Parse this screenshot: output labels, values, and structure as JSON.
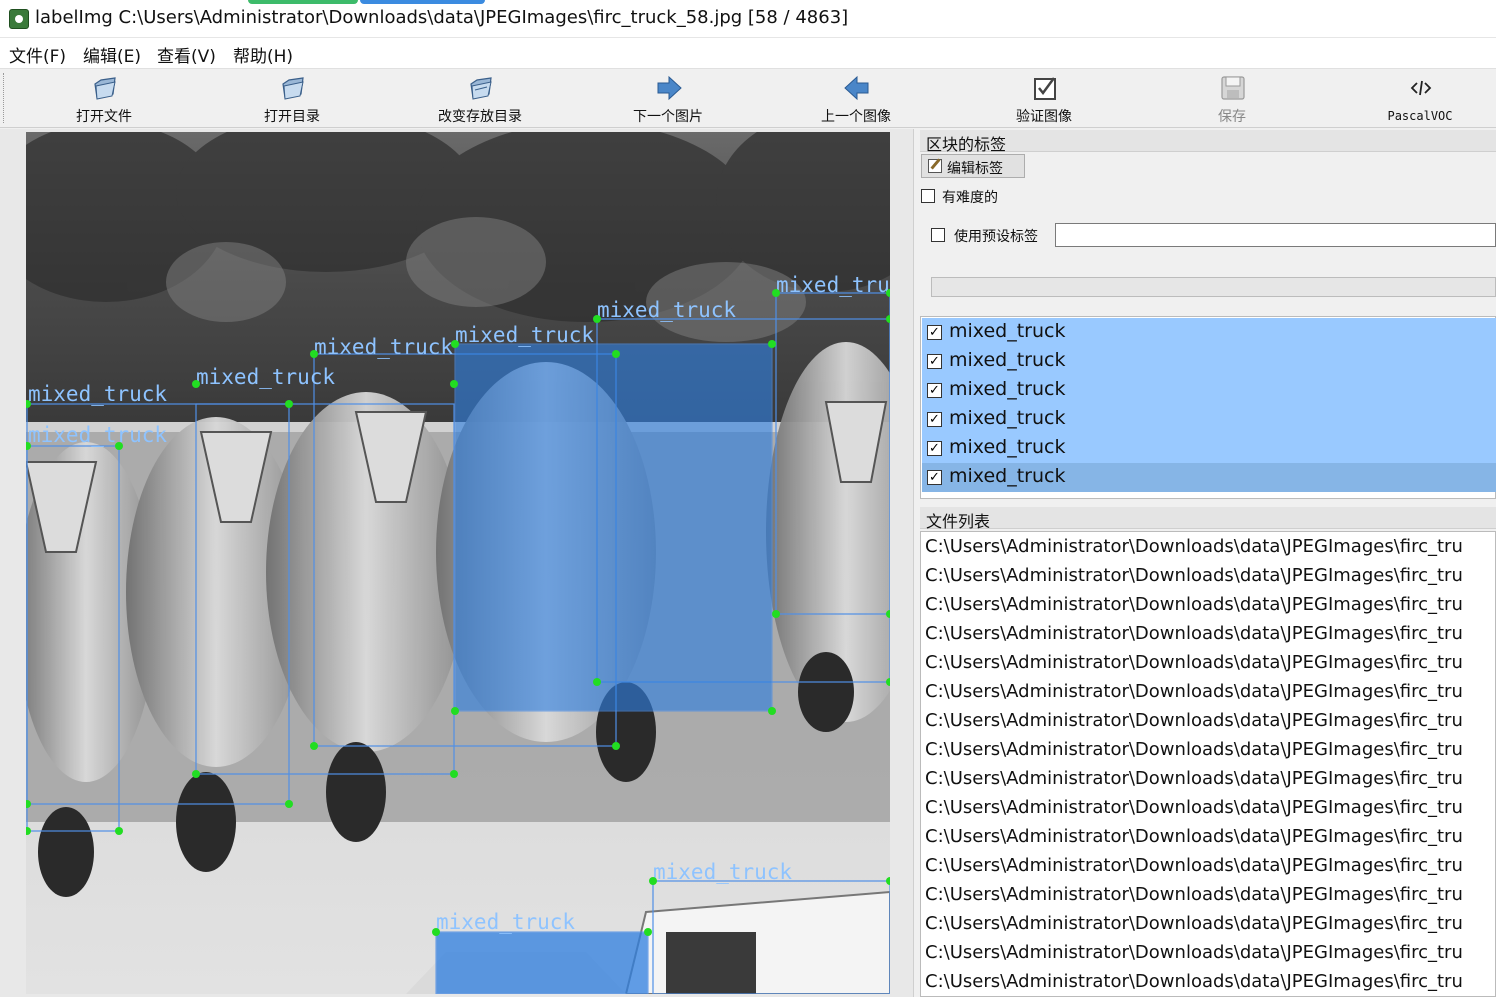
{
  "window": {
    "title": "labelImg C:\\Users\\Administrator\\Downloads\\data\\JPEGImages\\firc_truck_58.jpg [58 / 4863]"
  },
  "menu": [
    {
      "label": "文件(F)"
    },
    {
      "label": "编辑(E)"
    },
    {
      "label": "查看(V)"
    },
    {
      "label": "帮助(H)"
    }
  ],
  "toolbar": [
    {
      "label": "打开文件",
      "icon": "folder-icon",
      "enabled": true
    },
    {
      "label": "打开目录",
      "icon": "folder-icon",
      "enabled": true
    },
    {
      "label": "改变存放目录",
      "icon": "folder-icon",
      "enabled": true
    },
    {
      "label": "下一个图片",
      "icon": "arrow-right-icon",
      "enabled": true
    },
    {
      "label": "上一个图像",
      "icon": "arrow-left-icon",
      "enabled": true
    },
    {
      "label": "验证图像",
      "icon": "check-icon",
      "enabled": true
    },
    {
      "label": "保存",
      "icon": "save-icon",
      "enabled": false
    },
    {
      "label": "PascalVOC",
      "icon": "code-icon",
      "enabled": true
    }
  ],
  "canvas": {
    "image_name": "firc_truck_58.jpg",
    "boxes": [
      {
        "label": "mixed_truck",
        "filled": false
      },
      {
        "label": "mixed_truck",
        "filled": false
      },
      {
        "label": "mixed_truck",
        "filled": false
      },
      {
        "label": "mixed_truck",
        "filled": true
      },
      {
        "label": "mixed_truck",
        "filled": false
      },
      {
        "label": "mixed_truck",
        "filled": false
      },
      {
        "label": "mixed_truck",
        "filled": false
      },
      {
        "label": "mixed_truck",
        "filled": true
      },
      {
        "label": "mixed_truck",
        "filled": false
      }
    ]
  },
  "box_labels_panel": {
    "title": "区块的标签",
    "edit_button": "编辑标签",
    "difficult_label": "有难度的",
    "difficult_checked": false,
    "use_default_label": "使用预设标签",
    "use_default_checked": false,
    "default_label_value": "",
    "labels": [
      {
        "text": "mixed_truck",
        "checked": true,
        "selected": false
      },
      {
        "text": "mixed_truck",
        "checked": true,
        "selected": false
      },
      {
        "text": "mixed_truck",
        "checked": true,
        "selected": false
      },
      {
        "text": "mixed_truck",
        "checked": true,
        "selected": false
      },
      {
        "text": "mixed_truck",
        "checked": true,
        "selected": false
      },
      {
        "text": "mixed_truck",
        "checked": true,
        "selected": true
      }
    ]
  },
  "file_list_panel": {
    "title": "文件列表",
    "files": [
      "C:\\Users\\Administrator\\Downloads\\data\\JPEGImages\\firc_tru",
      "C:\\Users\\Administrator\\Downloads\\data\\JPEGImages\\firc_tru",
      "C:\\Users\\Administrator\\Downloads\\data\\JPEGImages\\firc_tru",
      "C:\\Users\\Administrator\\Downloads\\data\\JPEGImages\\firc_tru",
      "C:\\Users\\Administrator\\Downloads\\data\\JPEGImages\\firc_tru",
      "C:\\Users\\Administrator\\Downloads\\data\\JPEGImages\\firc_tru",
      "C:\\Users\\Administrator\\Downloads\\data\\JPEGImages\\firc_tru",
      "C:\\Users\\Administrator\\Downloads\\data\\JPEGImages\\firc_tru",
      "C:\\Users\\Administrator\\Downloads\\data\\JPEGImages\\firc_tru",
      "C:\\Users\\Administrator\\Downloads\\data\\JPEGImages\\firc_tru",
      "C:\\Users\\Administrator\\Downloads\\data\\JPEGImages\\firc_tru",
      "C:\\Users\\Administrator\\Downloads\\data\\JPEGImages\\firc_tru",
      "C:\\Users\\Administrator\\Downloads\\data\\JPEGImages\\firc_tru",
      "C:\\Users\\Administrator\\Downloads\\data\\JPEGImages\\firc_tru",
      "C:\\Users\\Administrator\\Downloads\\data\\JPEGImages\\firc_tru",
      "C:\\Users\\Administrator\\Downloads\\data\\JPEGImages\\firc_tru"
    ]
  },
  "colors": {
    "box_stroke": "#4f8fe6",
    "box_fill": "#2f7fe0",
    "box_label_text": "#8ec3ff",
    "vertex": "#22dd22",
    "list_highlight": "#99c9ff",
    "list_selected": "#86b5e6"
  }
}
